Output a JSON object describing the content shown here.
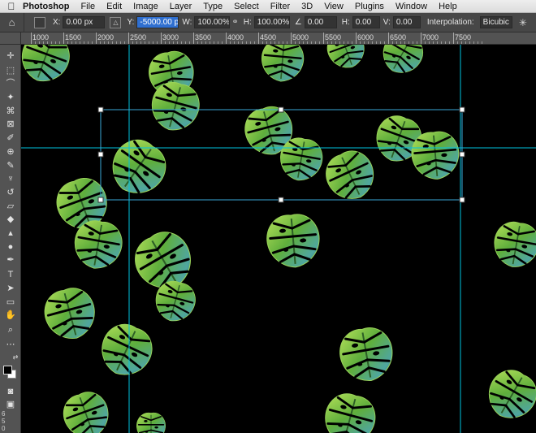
{
  "menubar": {
    "apple_icon": "apple-logo-icon",
    "app_name": "Photoshop",
    "items": [
      "File",
      "Edit",
      "Image",
      "Layer",
      "Type",
      "Select",
      "Filter",
      "3D",
      "View",
      "Plugins",
      "Window",
      "Help"
    ]
  },
  "options": {
    "home_icon": "home-icon",
    "x_label": "X:",
    "x_value": "0.00 px",
    "y_label": "Y:",
    "y_value": "-5000.00 p",
    "w_label": "W:",
    "w_value": "100.00%",
    "h_label": "H:",
    "h_value": "100.00%",
    "angle_value": "0.00",
    "hskew_label": "H:",
    "hskew_value": "0.00",
    "vskew_label": "V:",
    "vskew_value": "0.00",
    "interp_label": "Interpolation:",
    "interp_value": "Bicubic",
    "link_icon": "link-icon",
    "warp_icon": "warp-icon"
  },
  "ruler": {
    "labels": [
      "1000",
      "1500",
      "2000",
      "2500",
      "3000",
      "3500",
      "4000",
      "4500",
      "5000",
      "5500",
      "6000",
      "6500",
      "7000",
      "7500"
    ]
  },
  "vruler": {
    "digits": [
      "6",
      "5",
      "0"
    ]
  },
  "tools": [
    "move-tool-icon",
    "marquee-tool-icon",
    "lasso-tool-icon",
    "quick-select-tool-icon",
    "crop-tool-icon",
    "frame-tool-icon",
    "eyedropper-tool-icon",
    "healing-brush-tool-icon",
    "brush-tool-icon",
    "clone-stamp-tool-icon",
    "history-brush-tool-icon",
    "eraser-tool-icon",
    "paint-bucket-tool-icon",
    "blur-tool-icon",
    "dodge-tool-icon",
    "pen-tool-icon",
    "type-tool-icon",
    "path-select-tool-icon",
    "shape-tool-icon",
    "hand-tool-icon",
    "zoom-tool-icon",
    "more-tools-icon",
    "swap-colors-icon",
    "quick-mask-icon",
    "screen-mode-icon"
  ],
  "colors": {
    "foreground": "#000000",
    "background": "#ffffff",
    "guide": "#00c3e0",
    "selection_field": "#2f6fd0"
  }
}
